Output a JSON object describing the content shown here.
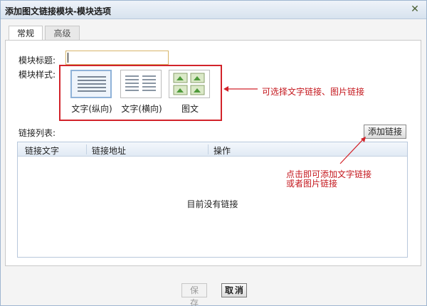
{
  "window": {
    "title": "添加图文链接模块-模块选项",
    "close_glyph": "✕"
  },
  "tabs": [
    {
      "label": "常规"
    },
    {
      "label": "高级"
    }
  ],
  "form": {
    "module_title_label": "模块标题:",
    "module_title_value": "",
    "module_style_label": "模块样式:",
    "style_options": [
      {
        "label": "文字(纵向)",
        "icon": "text-vertical-list-icon",
        "selected": true
      },
      {
        "label": "文字(横向)",
        "icon": "text-horizontal-list-icon",
        "selected": false
      },
      {
        "label": "图文",
        "icon": "image-text-grid-icon",
        "selected": false
      }
    ]
  },
  "link_list": {
    "label": "链接列表:",
    "add_button": "添加链接",
    "columns": [
      "链接文字",
      "链接地址",
      "操作"
    ],
    "empty_text": "目前没有链接"
  },
  "annotations": {
    "style_note": "可选择文字链接、图片链接",
    "add_note_line1": "点击即可添加文字链接",
    "add_note_line2": "或者图片链接",
    "color": "#d2232a"
  },
  "footer": {
    "save_label": "保存",
    "cancel_label": "取消"
  }
}
